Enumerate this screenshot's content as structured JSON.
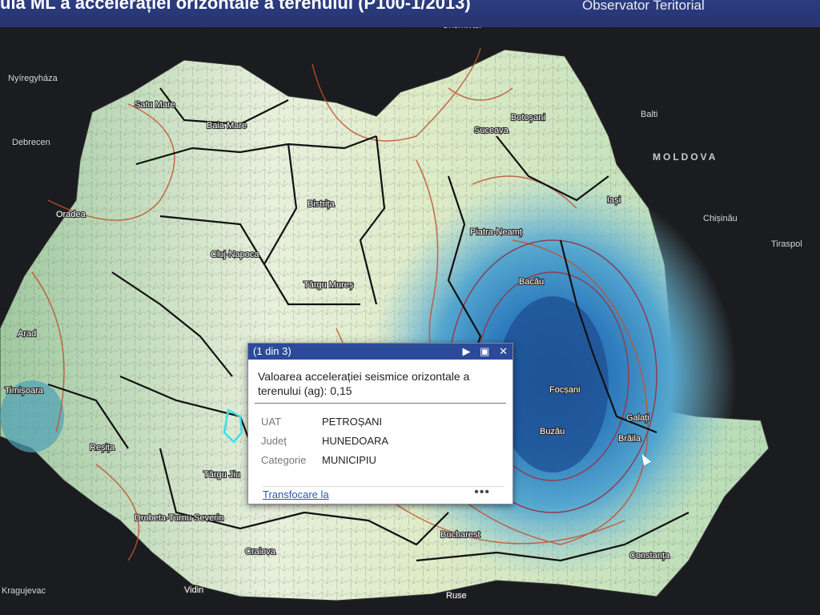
{
  "header": {
    "title": "ula ML a accelerației orizontale a terenului (P100-1/2013)",
    "brand": "Observator Teritorial"
  },
  "popup": {
    "counter": "(1 din 3)",
    "icons": {
      "next": "play-icon",
      "maximize": "maximize-icon",
      "close": "close-icon"
    },
    "title": "Valoarea accelerației seismice orizontale a terenului (ag): 0,15",
    "fields": [
      {
        "key": "UAT",
        "value": "PETROȘANI"
      },
      {
        "key": "Județ",
        "value": "HUNEDOARA"
      },
      {
        "key": "Categorie",
        "value": "MUNICIPIU"
      }
    ],
    "zoom_link": "Transfocare la",
    "more": "•••"
  },
  "map": {
    "ag_value": 0.15,
    "cities_ro": [
      "Satu Mare",
      "Baia Mare",
      "Suceava",
      "Botoșani",
      "Oradea",
      "Bistrița",
      "Iași",
      "Cluj-Napoca",
      "Piatra-Neamț",
      "Târgu Mureș",
      "Bacău",
      "Arad",
      "Timișoara",
      "Focșani",
      "Galați",
      "Brăila",
      "Reșița",
      "Buzău",
      "Târgu Jiu",
      "Drobeta-Turnu Severin",
      "Bucharest",
      "Craiova",
      "Constanța",
      "Ruse",
      "Vidin"
    ],
    "places_ext": [
      "Nyíregyháza",
      "Debrecen",
      "Chernivtsi",
      "Balti",
      "Chișinău",
      "Tiraspol",
      "Kragujevac"
    ],
    "country_label": "MOLDOVA"
  }
}
